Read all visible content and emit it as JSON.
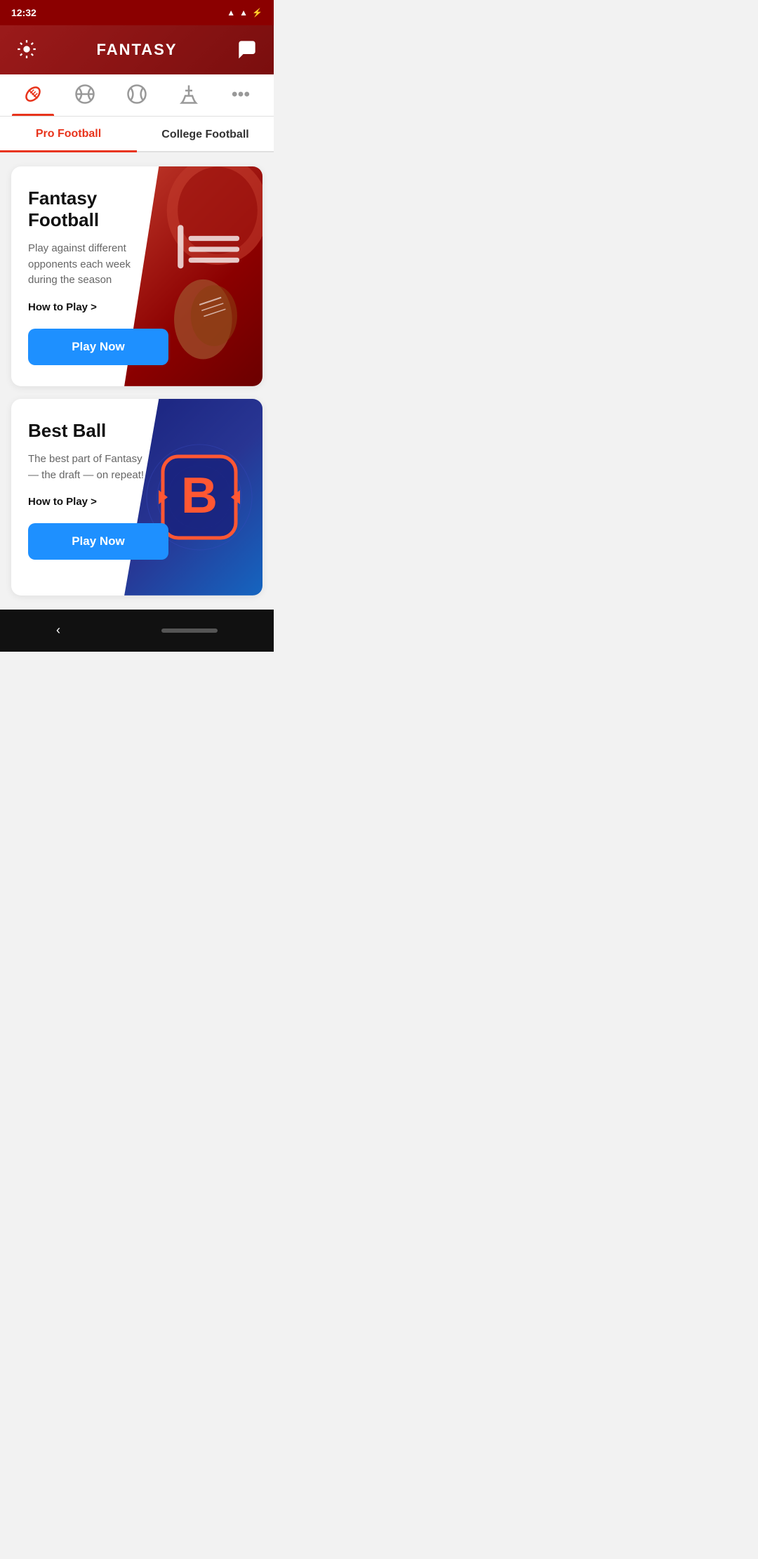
{
  "statusBar": {
    "time": "12:32",
    "icons": [
      "image",
      "navigation",
      "diamond",
      "suitcase",
      "dot"
    ]
  },
  "header": {
    "title": "FANTASY",
    "settingsLabel": "settings",
    "messageLabel": "messages"
  },
  "sportTabs": [
    {
      "id": "football",
      "label": "Football",
      "active": true
    },
    {
      "id": "basketball",
      "label": "Basketball",
      "active": false
    },
    {
      "id": "baseball",
      "label": "Baseball",
      "active": false
    },
    {
      "id": "hockey",
      "label": "Hockey",
      "active": false
    },
    {
      "id": "more",
      "label": "More",
      "active": false
    }
  ],
  "subTabs": [
    {
      "id": "pro-football",
      "label": "Pro Football",
      "active": true
    },
    {
      "id": "college-football",
      "label": "College Football",
      "active": false
    }
  ],
  "cards": [
    {
      "id": "fantasy-football",
      "title": "Fantasy Football",
      "description": "Play against different opponents each week during the season",
      "howToPlay": "How to Play >",
      "playNow": "Play Now",
      "imageType": "football"
    },
    {
      "id": "best-ball",
      "title": "Best Ball",
      "description": "The best part of Fantasy — the draft — on repeat!",
      "howToPlay": "How to Play >",
      "playNow": "Play Now",
      "imageType": "bestball"
    }
  ],
  "colors": {
    "headerBg": "#8b0000",
    "activeTab": "#e8341c",
    "playButton": "#1e90ff",
    "footballBg": "#c0392b",
    "bestballBg": "#1a237e"
  }
}
